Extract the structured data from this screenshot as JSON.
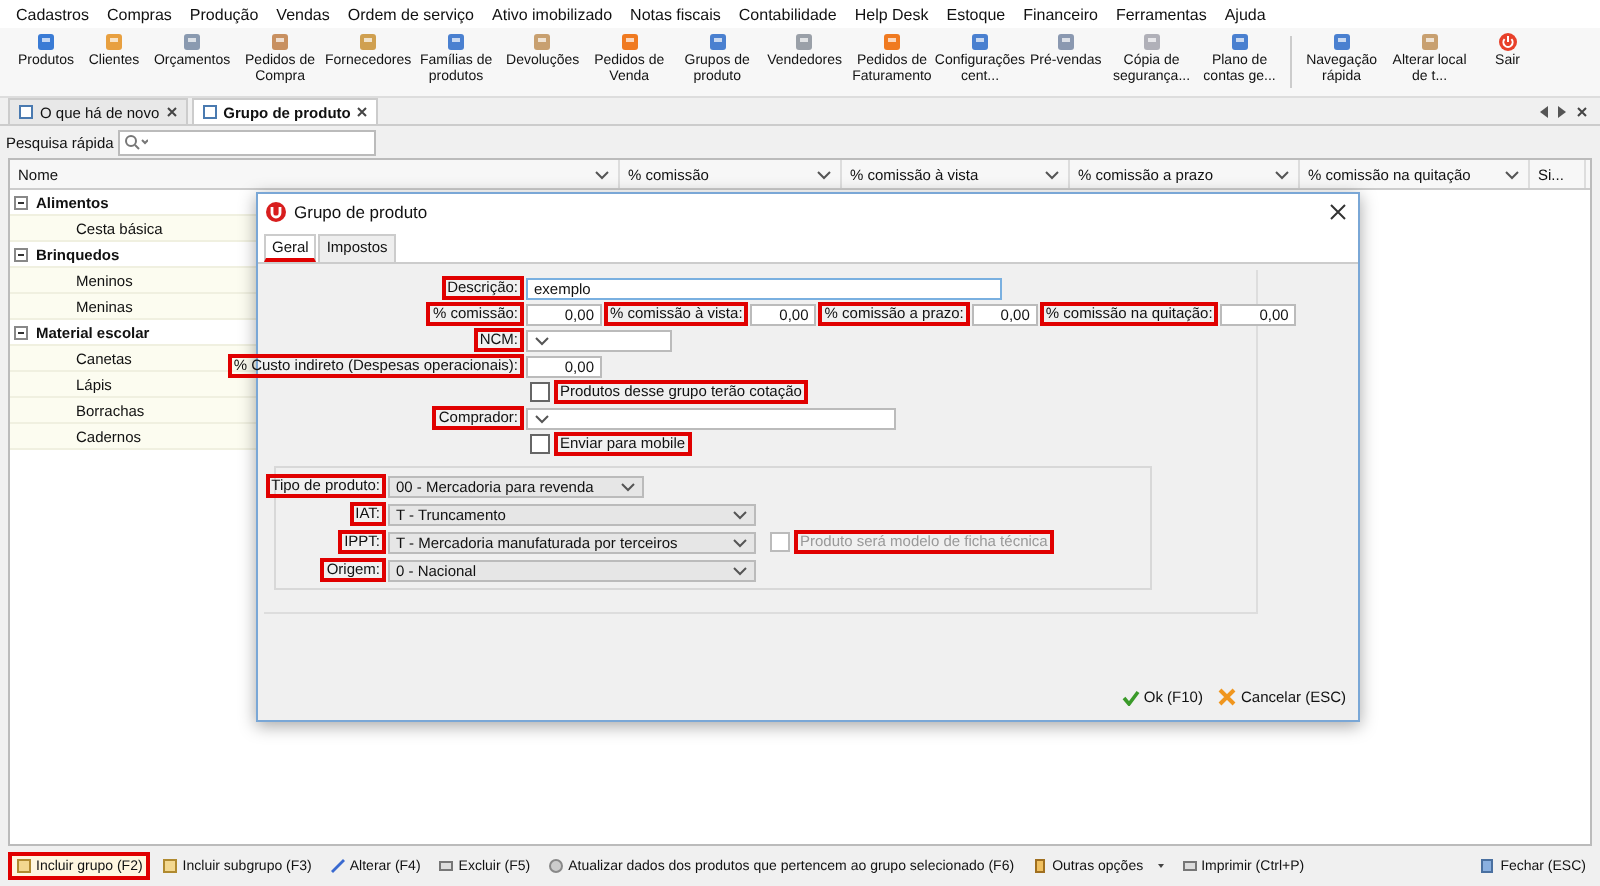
{
  "menu": [
    "Cadastros",
    "Compras",
    "Produção",
    "Vendas",
    "Ordem de serviço",
    "Ativo imobilizado",
    "Notas fiscais",
    "Contabilidade",
    "Help Desk",
    "Estoque",
    "Financeiro",
    "Ferramentas",
    "Ajuda"
  ],
  "toolbar": {
    "groups": [
      [
        {
          "label": "Produtos",
          "kind": "launch"
        },
        {
          "label": "Clientes",
          "kind": "launch"
        },
        {
          "label": "Orçamentos",
          "kind": "launch"
        },
        {
          "label": "Pedidos de Compra",
          "kind": "launch"
        },
        {
          "label": "Fornecedores",
          "kind": "launch"
        },
        {
          "label": "Famílias de produtos",
          "kind": "launch"
        },
        {
          "label": "Devoluções",
          "kind": "launch"
        },
        {
          "label": "Pedidos de Venda",
          "kind": "launch"
        },
        {
          "label": "Grupos de produto",
          "kind": "launch"
        },
        {
          "label": "Vendedores",
          "kind": "launch"
        },
        {
          "label": "Pedidos de Faturamento",
          "kind": "launch"
        },
        {
          "label": "Configurações cent...",
          "kind": "launch"
        },
        {
          "label": "Pré-vendas",
          "kind": "launch"
        },
        {
          "label": "Cópia de segurança...",
          "kind": "launch"
        },
        {
          "label": "Plano de contas ge...",
          "kind": "launch"
        }
      ],
      [
        {
          "label": "Navegação rápida",
          "kind": "launch"
        },
        {
          "label": "Alterar local de t...",
          "kind": "launch"
        },
        {
          "label": "Sair",
          "kind": "exit"
        }
      ]
    ]
  },
  "doc_tabs": [
    {
      "label": "O que há de novo",
      "selected": false
    },
    {
      "label": "Grupo de produto",
      "selected": true
    }
  ],
  "search": {
    "label": "Pesquisa rápida"
  },
  "grid": {
    "columns": [
      "Nome",
      "% comissão",
      "% comissão à vista",
      "% comissão a prazo",
      "% comissão na quitação",
      "Si..."
    ],
    "rows": [
      {
        "label": "Alimentos",
        "expanded": true,
        "children": [
          {
            "label": "Cesta básica"
          }
        ]
      },
      {
        "label": "Brinquedos",
        "expanded": true,
        "children": [
          {
            "label": "Meninos"
          },
          {
            "label": "Meninas"
          }
        ]
      },
      {
        "label": "Material escolar",
        "expanded": true,
        "children": [
          {
            "label": "Canetas"
          },
          {
            "label": "Lápis"
          },
          {
            "label": "Borrachas"
          },
          {
            "label": "Cadernos"
          }
        ]
      }
    ]
  },
  "dialog": {
    "title": "Grupo de produto",
    "tabs": [
      {
        "label": "Geral",
        "selected": true
      },
      {
        "label": "Impostos",
        "selected": false
      }
    ],
    "descricao": {
      "label": "Descrição:",
      "value": "exemplo",
      "highlighted": true
    },
    "commissions": [
      {
        "label": "% comissão:",
        "value": "0,00",
        "highlighted": true
      },
      {
        "label": "% comissão à vista:",
        "value": "0,00",
        "highlighted": true
      },
      {
        "label": "% comissão a prazo:",
        "value": "0,00",
        "highlighted": true
      },
      {
        "label": "% comissão na quitação:",
        "value": "0,00",
        "highlighted": true
      }
    ],
    "ncm": {
      "label": "NCM:",
      "highlighted": true
    },
    "custo_indireto": {
      "label": "% Custo indireto (Despesas operacionais):",
      "value": "0,00",
      "highlighted": true
    },
    "cotacao": {
      "label": "Produtos desse grupo terão cotação",
      "checked": false,
      "highlighted": true
    },
    "comprador": {
      "label": "Comprador:",
      "highlighted": true
    },
    "mobile": {
      "label": "Enviar para mobile",
      "checked": false,
      "highlighted": true
    },
    "taxes": [
      {
        "label": "Tipo de produto:",
        "value": "00 - Mercadoria para revenda",
        "highlighted": true
      },
      {
        "label": "IAT:",
        "value": "T - Truncamento",
        "highlighted": true
      },
      {
        "label": "IPPT:",
        "value": "T - Mercadoria manufaturada por terceiros",
        "highlighted": true
      },
      {
        "label": "Origem:",
        "value": "0 - Nacional",
        "highlighted": true
      }
    ],
    "ficha_tecnica": {
      "label": "Produto será modelo de ficha técnica",
      "checked": false,
      "disabled": true,
      "highlighted": true
    },
    "buttons": [
      {
        "label": "Ok (F10)",
        "kind": "ok"
      },
      {
        "label": "Cancelar (ESC)",
        "kind": "cancel"
      }
    ]
  },
  "bottom_bar": {
    "actions": [
      {
        "label": "Incluir grupo (F2)",
        "highlighted": true,
        "kind": "add"
      },
      {
        "label": "Incluir subgrupo (F3)",
        "highlighted": false,
        "kind": "add"
      },
      {
        "label": "Alterar (F4)",
        "highlighted": false,
        "kind": "edit"
      },
      {
        "label": "Excluir (F5)",
        "highlighted": false,
        "kind": "delete"
      },
      {
        "label": "Atualizar dados dos produtos que pertencem ao grupo selecionado (F6)",
        "highlighted": false,
        "kind": "update"
      },
      {
        "label": "Outras opções",
        "highlighted": false,
        "kind": "menu"
      },
      {
        "label": "Imprimir (Ctrl+P)",
        "highlighted": false,
        "kind": "print"
      }
    ],
    "close": "Fechar (ESC)"
  }
}
